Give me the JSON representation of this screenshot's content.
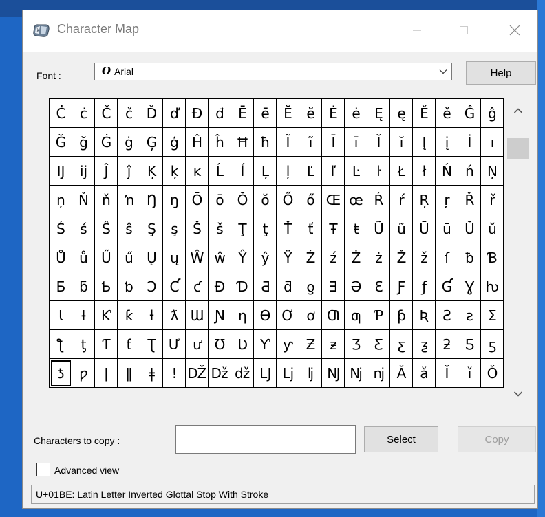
{
  "window": {
    "title": "Character Map",
    "accent": "#0078d7"
  },
  "font": {
    "label": "Font :",
    "icon_glyph": "O",
    "value": "Arial"
  },
  "help_label": "Help",
  "characters": [
    [
      "Ċ",
      "ċ",
      "Č",
      "č",
      "Ď",
      "ď",
      "Đ",
      "đ",
      "Ē",
      "ē",
      "Ĕ",
      "ĕ",
      "Ė",
      "ė",
      "Ę",
      "ę",
      "Ě",
      "ě",
      "Ĝ",
      "ĝ"
    ],
    [
      "Ğ",
      "ğ",
      "Ġ",
      "ġ",
      "Ģ",
      "ģ",
      "Ĥ",
      "ĥ",
      "Ħ",
      "ħ",
      "Ĩ",
      "ĩ",
      "Ī",
      "ī",
      "Ĭ",
      "ĭ",
      "Į",
      "į",
      "İ",
      "ı"
    ],
    [
      "Ĳ",
      "ĳ",
      "Ĵ",
      "ĵ",
      "Ķ",
      "ķ",
      "ĸ",
      "Ĺ",
      "ĺ",
      "Ļ",
      "ļ",
      "Ľ",
      "ľ",
      "Ŀ",
      "ŀ",
      "Ł",
      "ł",
      "Ń",
      "ń",
      "Ņ"
    ],
    [
      "ņ",
      "Ň",
      "ň",
      "ŉ",
      "Ŋ",
      "ŋ",
      "Ō",
      "ō",
      "Ŏ",
      "ŏ",
      "Ő",
      "ő",
      "Œ",
      "œ",
      "Ŕ",
      "ŕ",
      "Ŗ",
      "ŗ",
      "Ř",
      "ř"
    ],
    [
      "Ś",
      "ś",
      "Ŝ",
      "ŝ",
      "Ş",
      "ş",
      "Š",
      "š",
      "Ţ",
      "ţ",
      "Ť",
      "ť",
      "Ŧ",
      "ŧ",
      "Ũ",
      "ũ",
      "Ū",
      "ū",
      "Ŭ",
      "ŭ"
    ],
    [
      "Ů",
      "ů",
      "Ű",
      "ű",
      "Ų",
      "ų",
      "Ŵ",
      "ŵ",
      "Ŷ",
      "ŷ",
      "Ÿ",
      "Ź",
      "ź",
      "Ż",
      "ż",
      "Ž",
      "ž",
      "ſ",
      "ƀ",
      "Ɓ"
    ],
    [
      "Ƃ",
      "ƃ",
      "Ƅ",
      "ƅ",
      "Ɔ",
      "Ƈ",
      "ƈ",
      "Ɖ",
      "Ɗ",
      "Ƌ",
      "ƌ",
      "ƍ",
      "Ǝ",
      "Ə",
      "Ɛ",
      "Ƒ",
      "ƒ",
      "Ɠ",
      "Ɣ",
      "ƕ"
    ],
    [
      "Ɩ",
      "Ɨ",
      "Ƙ",
      "ƙ",
      "ƚ",
      "ƛ",
      "Ɯ",
      "Ɲ",
      "ƞ",
      "Ɵ",
      "Ơ",
      "ơ",
      "Ƣ",
      "ƣ",
      "Ƥ",
      "ƥ",
      "Ʀ",
      "Ƨ",
      "ƨ",
      "Ʃ"
    ],
    [
      "ƪ",
      "ƫ",
      "Ƭ",
      "ƭ",
      "Ʈ",
      "Ư",
      "ư",
      "Ʊ",
      "Ʋ",
      "Ƴ",
      "ƴ",
      "Ƶ",
      "ƶ",
      "Ʒ",
      "Ƹ",
      "ƹ",
      "ƺ",
      "ƻ",
      "Ƽ",
      "ƽ"
    ],
    [
      "ƾ",
      "ƿ",
      "ǀ",
      "ǁ",
      "ǂ",
      "ǃ",
      "Ǆ",
      "ǅ",
      "ǆ",
      "Ǉ",
      "ǈ",
      "ǉ",
      "Ǌ",
      "ǋ",
      "ǌ",
      "Ǎ",
      "ǎ",
      "Ǐ",
      "ǐ",
      "Ǒ"
    ]
  ],
  "selected_character": "ƾ",
  "copy": {
    "label": "Characters to copy :",
    "value": "",
    "select_label": "Select",
    "copy_label": "Copy"
  },
  "advanced_view": {
    "label": "Advanced view",
    "checked": false
  },
  "status": "U+01BE: Latin Letter Inverted Glottal Stop With Stroke"
}
